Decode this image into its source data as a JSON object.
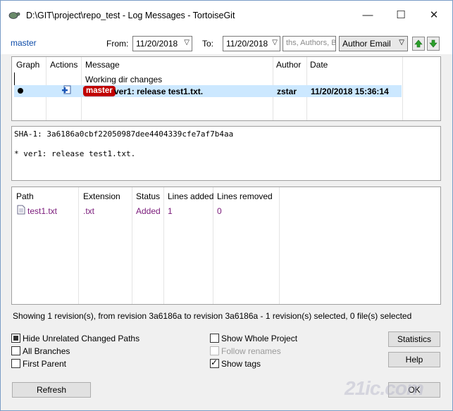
{
  "window": {
    "title": "D:\\GIT\\project\\repo_test - Log Messages - TortoiseGit",
    "controls": {
      "minimize": "—",
      "maximize": "☐",
      "close": "✕"
    }
  },
  "toolbar": {
    "branch": "master",
    "from_label": "From:",
    "from_date": "11/20/2018",
    "to_label": "To:",
    "to_date": "11/20/2018",
    "search_placeholder": "ths, Authors, B",
    "filter_selected": "Author Email"
  },
  "log_list": {
    "columns": [
      "Graph",
      "Actions",
      "Message",
      "Author",
      "Date"
    ],
    "working_dir_row": "Working dir changes",
    "rows": [
      {
        "ref_badge": "master",
        "message": "ver1: release test1.txt.",
        "author": "zstar",
        "date": "11/20/2018 15:36:14"
      }
    ]
  },
  "commit_details": {
    "sha_line": "SHA-1: 3a6186a0cbf22050987dee4404339cfe7af7b4aa",
    "message_line": "* ver1: release test1.txt."
  },
  "files": {
    "columns": [
      "Path",
      "Extension",
      "Status",
      "Lines added",
      "Lines removed"
    ],
    "rows": [
      {
        "path": "test1.txt",
        "extension": ".txt",
        "status": "Added",
        "lines_added": "1",
        "lines_removed": "0"
      }
    ]
  },
  "status_text": "Showing 1 revision(s), from revision 3a6186a to revision 3a6186a - 1 revision(s) selected, 0 file(s) selected",
  "options": {
    "hide_unrelated": "Hide Unrelated Changed Paths",
    "all_branches": "All Branches",
    "first_parent": "First Parent",
    "show_whole_project": "Show Whole Project",
    "follow_renames": "Follow renames",
    "show_tags": "Show tags"
  },
  "buttons": {
    "statistics": "Statistics",
    "help": "Help",
    "refresh": "Refresh",
    "ok": "OK"
  },
  "watermark": "21ic.com"
}
